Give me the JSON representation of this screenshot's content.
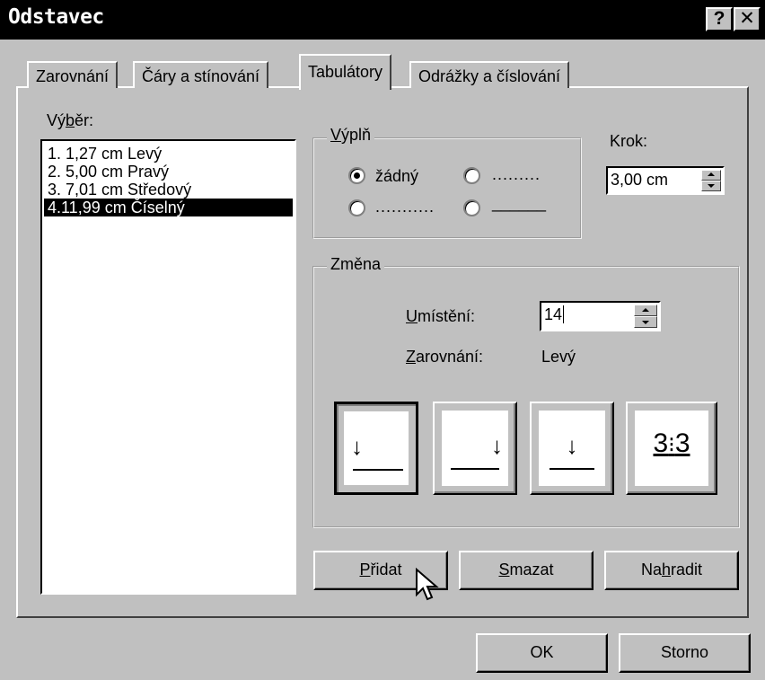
{
  "window": {
    "title": "Odstavec",
    "help_label": "?",
    "close_label": "✕"
  },
  "tabs": [
    {
      "label": "Zarovnání"
    },
    {
      "label": "Čáry a stínování"
    },
    {
      "label": "Tabulátory",
      "active": true
    },
    {
      "label": "Odrážky a číslování"
    }
  ],
  "selection": {
    "label_pre": "Vý",
    "label_ul": "b",
    "label_post": "ěr:",
    "items": [
      {
        "text": "1. 1,27 cm Levý"
      },
      {
        "text": "2. 5,00 cm Pravý"
      },
      {
        "text": "3. 7,01 cm Středový"
      },
      {
        "text": "4.11,99 cm Číselný",
        "selected": true
      }
    ]
  },
  "fill": {
    "legend_ul": "V",
    "legend_rest": "ýplň",
    "options": [
      {
        "label": "žádný",
        "checked": true
      },
      {
        "label": "........."
      },
      {
        "label": "..........."
      },
      {
        "label": "______"
      }
    ]
  },
  "step": {
    "label": "Krok:",
    "value": "3,00 cm"
  },
  "change": {
    "legend": "Změna",
    "position_label_ul": "U",
    "position_label_rest": "místění:",
    "position_value": "14",
    "alignment_label_ul": "Z",
    "alignment_label_rest": "arovnání:",
    "alignment_value": "Levý",
    "align_buttons": [
      {
        "name": "left-tab",
        "glyph": "↓",
        "pressed": true
      },
      {
        "name": "right-tab",
        "glyph": "↓"
      },
      {
        "name": "center-tab",
        "glyph": "↓"
      },
      {
        "name": "decimal-tab",
        "glyph_left": "3",
        "glyph_mid": "⁝",
        "glyph_right": "3"
      }
    ]
  },
  "actions": {
    "add_ul": "P",
    "add_rest": "řidat",
    "delete_ul": "S",
    "delete_rest": "mazat",
    "replace_pre": "Na",
    "replace_ul": "h",
    "replace_post": "radit"
  },
  "footer": {
    "ok_label": "OK",
    "cancel_label": "Storno"
  }
}
